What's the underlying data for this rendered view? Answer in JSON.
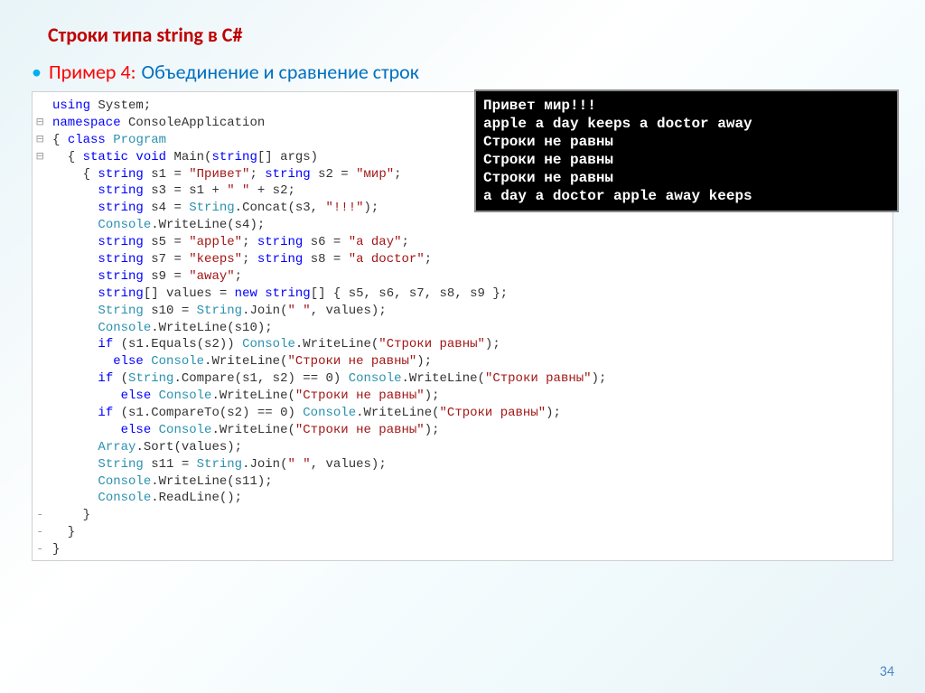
{
  "title": "Строки типа string в C#",
  "example_label": "Пример 4:",
  "example_desc": "Объединение и сравнение строк",
  "console_output": "Привет мир!!!\napple a day keeps a doctor away\nСтроки не равны\nСтроки не равны\nСтроки не равны\na day a doctor apple away keeps",
  "page_number": "34",
  "code": {
    "l01a": "using ",
    "l01b": "System",
    "l01c": ";",
    "l02a": "namespace ",
    "l02b": "ConsoleApplication",
    "l03a": "{ ",
    "l03b": "class ",
    "l03c": "Program",
    "l04a": "  { ",
    "l04b": "static void ",
    "l04c": "Main(",
    "l04d": "string",
    "l04e": "[] args)",
    "l05a": "    { ",
    "l05b": "string ",
    "l05c": "s1 = ",
    "l05d": "\"Привет\"",
    "l05e": "; ",
    "l05f": "string ",
    "l05g": "s2 = ",
    "l05h": "\"мир\"",
    "l05i": ";",
    "l06a": "      ",
    "l06b": "string ",
    "l06c": "s3 = s1 + ",
    "l06d": "\" \"",
    "l06e": " + s2;",
    "l07a": "      ",
    "l07b": "string ",
    "l07c": "s4 = ",
    "l07d": "String",
    "l07e": ".Concat(s3, ",
    "l07f": "\"!!!\"",
    "l07g": ");",
    "l08a": "      ",
    "l08b": "Console",
    "l08c": ".WriteLine(s4);",
    "l09a": "      ",
    "l09b": "string ",
    "l09c": "s5 = ",
    "l09d": "\"apple\"",
    "l09e": "; ",
    "l09f": "string ",
    "l09g": "s6 = ",
    "l09h": "\"a day\"",
    "l09i": ";",
    "l10a": "      ",
    "l10b": "string ",
    "l10c": "s7 = ",
    "l10d": "\"keeps\"",
    "l10e": "; ",
    "l10f": "string ",
    "l10g": "s8 = ",
    "l10h": "\"a doctor\"",
    "l10i": ";",
    "l11a": "      ",
    "l11b": "string ",
    "l11c": "s9 = ",
    "l11d": "\"away\"",
    "l11e": ";",
    "l12a": "      ",
    "l12b": "string",
    "l12c": "[] values = ",
    "l12d": "new string",
    "l12e": "[] { s5, s6, s7, s8, s9 };",
    "l13a": "      ",
    "l13b": "String ",
    "l13c": "s10 = ",
    "l13d": "String",
    "l13e": ".Join(",
    "l13f": "\" \"",
    "l13g": ", values);",
    "l14a": "      ",
    "l14b": "Console",
    "l14c": ".WriteLine(s10);",
    "l15a": "      ",
    "l15b": "if ",
    "l15c": "(s1.Equals(s2)) ",
    "l15d": "Console",
    "l15e": ".WriteLine(",
    "l15f": "\"Строки равны\"",
    "l15g": ");",
    "l16a": "        ",
    "l16b": "else ",
    "l16c": "Console",
    "l16d": ".WriteLine(",
    "l16e": "\"Строки не равны\"",
    "l16f": ");",
    "l17a": "      ",
    "l17b": "if ",
    "l17c": "(",
    "l17d": "String",
    "l17e": ".Compare(s1, s2) == 0) ",
    "l17f": "Console",
    "l17g": ".WriteLine(",
    "l17h": "\"Строки равны\"",
    "l17i": ");",
    "l18a": "         ",
    "l18b": "else ",
    "l18c": "Console",
    "l18d": ".WriteLine(",
    "l18e": "\"Строки не равны\"",
    "l18f": ");",
    "l19a": "      ",
    "l19b": "if ",
    "l19c": "(s1.CompareTo(s2) == 0) ",
    "l19d": "Console",
    "l19e": ".WriteLine(",
    "l19f": "\"Строки равны\"",
    "l19g": ");",
    "l20a": "         ",
    "l20b": "else ",
    "l20c": "Console",
    "l20d": ".WriteLine(",
    "l20e": "\"Строки не равны\"",
    "l20f": ");",
    "l21a": "      ",
    "l21b": "Array",
    "l21c": ".Sort(values);",
    "l22a": "      ",
    "l22b": "String ",
    "l22c": "s11 = ",
    "l22d": "String",
    "l22e": ".Join(",
    "l22f": "\" \"",
    "l22g": ", values);",
    "l23a": "      ",
    "l23b": "Console",
    "l23c": ".WriteLine(s11);",
    "l24a": "      ",
    "l24b": "Console",
    "l24c": ".ReadLine();",
    "l25": "    }",
    "l26": "  }",
    "l27": "}"
  }
}
